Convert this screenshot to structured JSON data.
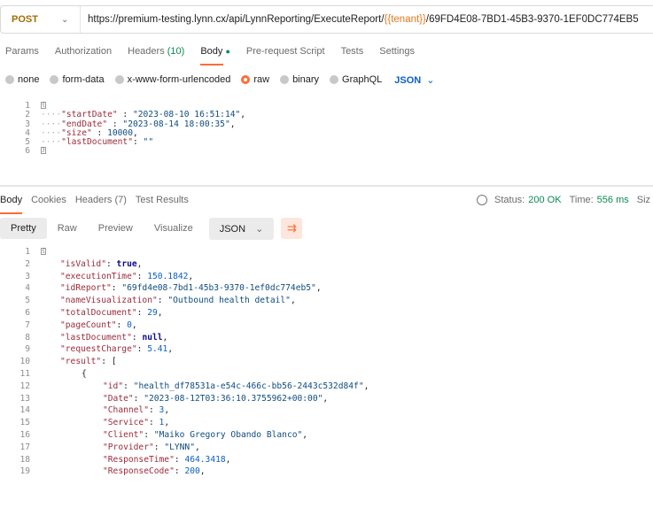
{
  "request": {
    "method": "POST",
    "url_prefix": "https://premium-testing.lynn.cx/api/LynnReporting/ExecuteReport/",
    "url_variable": "{{tenant}}",
    "url_suffix": "/69FD4E08-7BD1-45B3-9370-1EF0DC774EB5"
  },
  "request_tabs": [
    {
      "label": "Params"
    },
    {
      "label": "Authorization"
    },
    {
      "label": "Headers",
      "count": "(10)"
    },
    {
      "label": "Body",
      "active": true
    },
    {
      "label": "Pre-request Script"
    },
    {
      "label": "Tests"
    },
    {
      "label": "Settings"
    }
  ],
  "body_types": [
    "none",
    "form-data",
    "x-www-form-urlencoded",
    "raw",
    "binary",
    "GraphQL"
  ],
  "body_type_selected": "raw",
  "body_format": "JSON",
  "request_body": [
    {
      "ln": "1",
      "text": "{"
    },
    {
      "ln": "2",
      "key": "\"startDate\"",
      "sep": " : ",
      "val": "\"2023-08-10 16:51:14\"",
      "tail": ","
    },
    {
      "ln": "3",
      "key": "\"endDate\"",
      "sep": " : ",
      "val": "\"2023-08-14 18:00:35\"",
      "tail": ","
    },
    {
      "ln": "4",
      "key": "\"size\"",
      "sep": " : ",
      "val": "10000",
      "tail": ","
    },
    {
      "ln": "5",
      "key": "\"lastDocument\"",
      "sep": ": ",
      "val": "\"\"",
      "tail": ""
    },
    {
      "ln": "6",
      "text": "}"
    }
  ],
  "response_tabs": [
    "Body",
    "Cookies",
    "Headers (7)",
    "Test Results"
  ],
  "status": {
    "status_label": "Status:",
    "status_value": "200 OK",
    "time_label": "Time:",
    "time_value": "556 ms",
    "size_label": "Siz"
  },
  "view_options": [
    "Pretty",
    "Raw",
    "Preview",
    "Visualize"
  ],
  "response_format": "JSON",
  "response_body": [
    {
      "ln": "1",
      "indent": 0,
      "text": "{"
    },
    {
      "ln": "2",
      "indent": 1,
      "key": "\"isValid\"",
      "val": "true",
      "type": "b"
    },
    {
      "ln": "3",
      "indent": 1,
      "key": "\"executionTime\"",
      "val": "150.1842",
      "type": "n"
    },
    {
      "ln": "4",
      "indent": 1,
      "key": "\"idReport\"",
      "val": "\"69fd4e08-7bd1-45b3-9370-1ef0dc774eb5\"",
      "type": "s"
    },
    {
      "ln": "5",
      "indent": 1,
      "key": "\"nameVisualization\"",
      "val": "\"Outbound health detail\"",
      "type": "s"
    },
    {
      "ln": "6",
      "indent": 1,
      "key": "\"totalDocument\"",
      "val": "29",
      "type": "n"
    },
    {
      "ln": "7",
      "indent": 1,
      "key": "\"pageCount\"",
      "val": "0",
      "type": "n"
    },
    {
      "ln": "8",
      "indent": 1,
      "key": "\"lastDocument\"",
      "val": "null",
      "type": "b"
    },
    {
      "ln": "9",
      "indent": 1,
      "key": "\"requestCharge\"",
      "val": "5.41",
      "type": "n"
    },
    {
      "ln": "10",
      "indent": 1,
      "key": "\"result\"",
      "val": "[",
      "type": "p",
      "nocomma": true
    },
    {
      "ln": "11",
      "indent": 2,
      "text": "{"
    },
    {
      "ln": "12",
      "indent": 3,
      "key": "\"id\"",
      "val": "\"health_df78531a-e54c-466c-bb56-2443c532d84f\"",
      "type": "s"
    },
    {
      "ln": "13",
      "indent": 3,
      "key": "\"Date\"",
      "val": "\"2023-08-12T03:36:10.3755962+00:00\"",
      "type": "s"
    },
    {
      "ln": "14",
      "indent": 3,
      "key": "\"Channel\"",
      "val": "3",
      "type": "n"
    },
    {
      "ln": "15",
      "indent": 3,
      "key": "\"Service\"",
      "val": "1",
      "type": "n"
    },
    {
      "ln": "16",
      "indent": 3,
      "key": "\"Client\"",
      "val": "\"Maiko Gregory Obando Blanco\"",
      "type": "s"
    },
    {
      "ln": "17",
      "indent": 3,
      "key": "\"Provider\"",
      "val": "\"LYNN\"",
      "type": "s"
    },
    {
      "ln": "18",
      "indent": 3,
      "key": "\"ResponseTime\"",
      "val": "464.3418",
      "type": "n"
    },
    {
      "ln": "19",
      "indent": 3,
      "key": "\"ResponseCode\"",
      "val": "200",
      "type": "n"
    }
  ]
}
